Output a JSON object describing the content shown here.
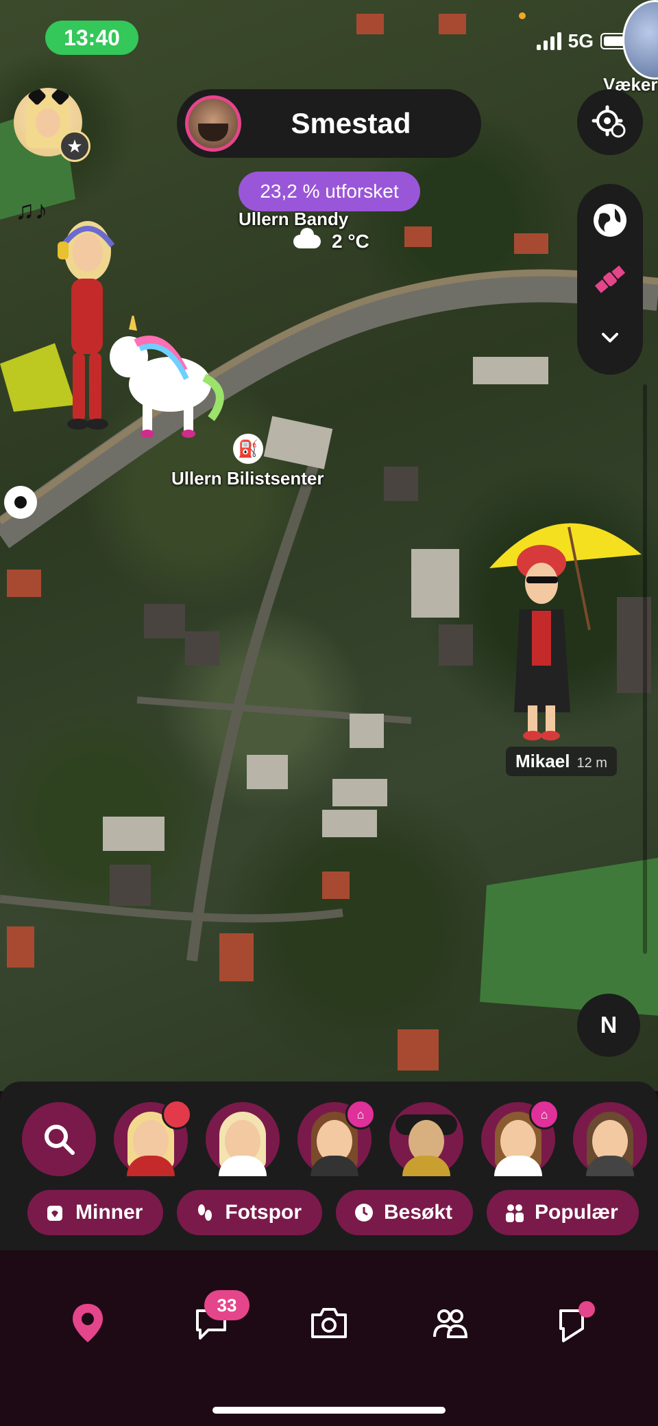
{
  "status_bar": {
    "time": "13:40",
    "network": "5G"
  },
  "map": {
    "location_title": "Smestad",
    "explored": "23,2 % utforsket",
    "labels": {
      "place_1": "Ullern Bandy",
      "place_2": "Ullern Bilistsenter",
      "corner_partial": "Væker"
    },
    "weather": {
      "temperature": "2 °C",
      "icon": "cloud-icon"
    },
    "friend": {
      "name": "Mikael",
      "distance": "12 m"
    },
    "compass": "N"
  },
  "tray": {
    "search_icon": "search-icon",
    "friends": [
      {
        "badge": "red"
      },
      {
        "badge": ""
      },
      {
        "badge": "home"
      },
      {
        "badge": ""
      },
      {
        "badge": "home"
      },
      {
        "badge": ""
      }
    ],
    "chips": [
      {
        "label": "Minner",
        "icon": "memories-icon"
      },
      {
        "label": "Fotspor",
        "icon": "footprints-icon"
      },
      {
        "label": "Besøkt",
        "icon": "clock-icon"
      },
      {
        "label": "Populær",
        "icon": "people-icon"
      }
    ]
  },
  "nav": {
    "items": [
      "map-icon",
      "chat-icon",
      "camera-icon",
      "friends-icon",
      "stories-icon"
    ],
    "chat_badge": "33"
  },
  "colors": {
    "accent": "#e5458a",
    "chip_bg": "#7a1a4a",
    "explored_bg": "#9a56d8",
    "time_pill": "#34c759"
  }
}
